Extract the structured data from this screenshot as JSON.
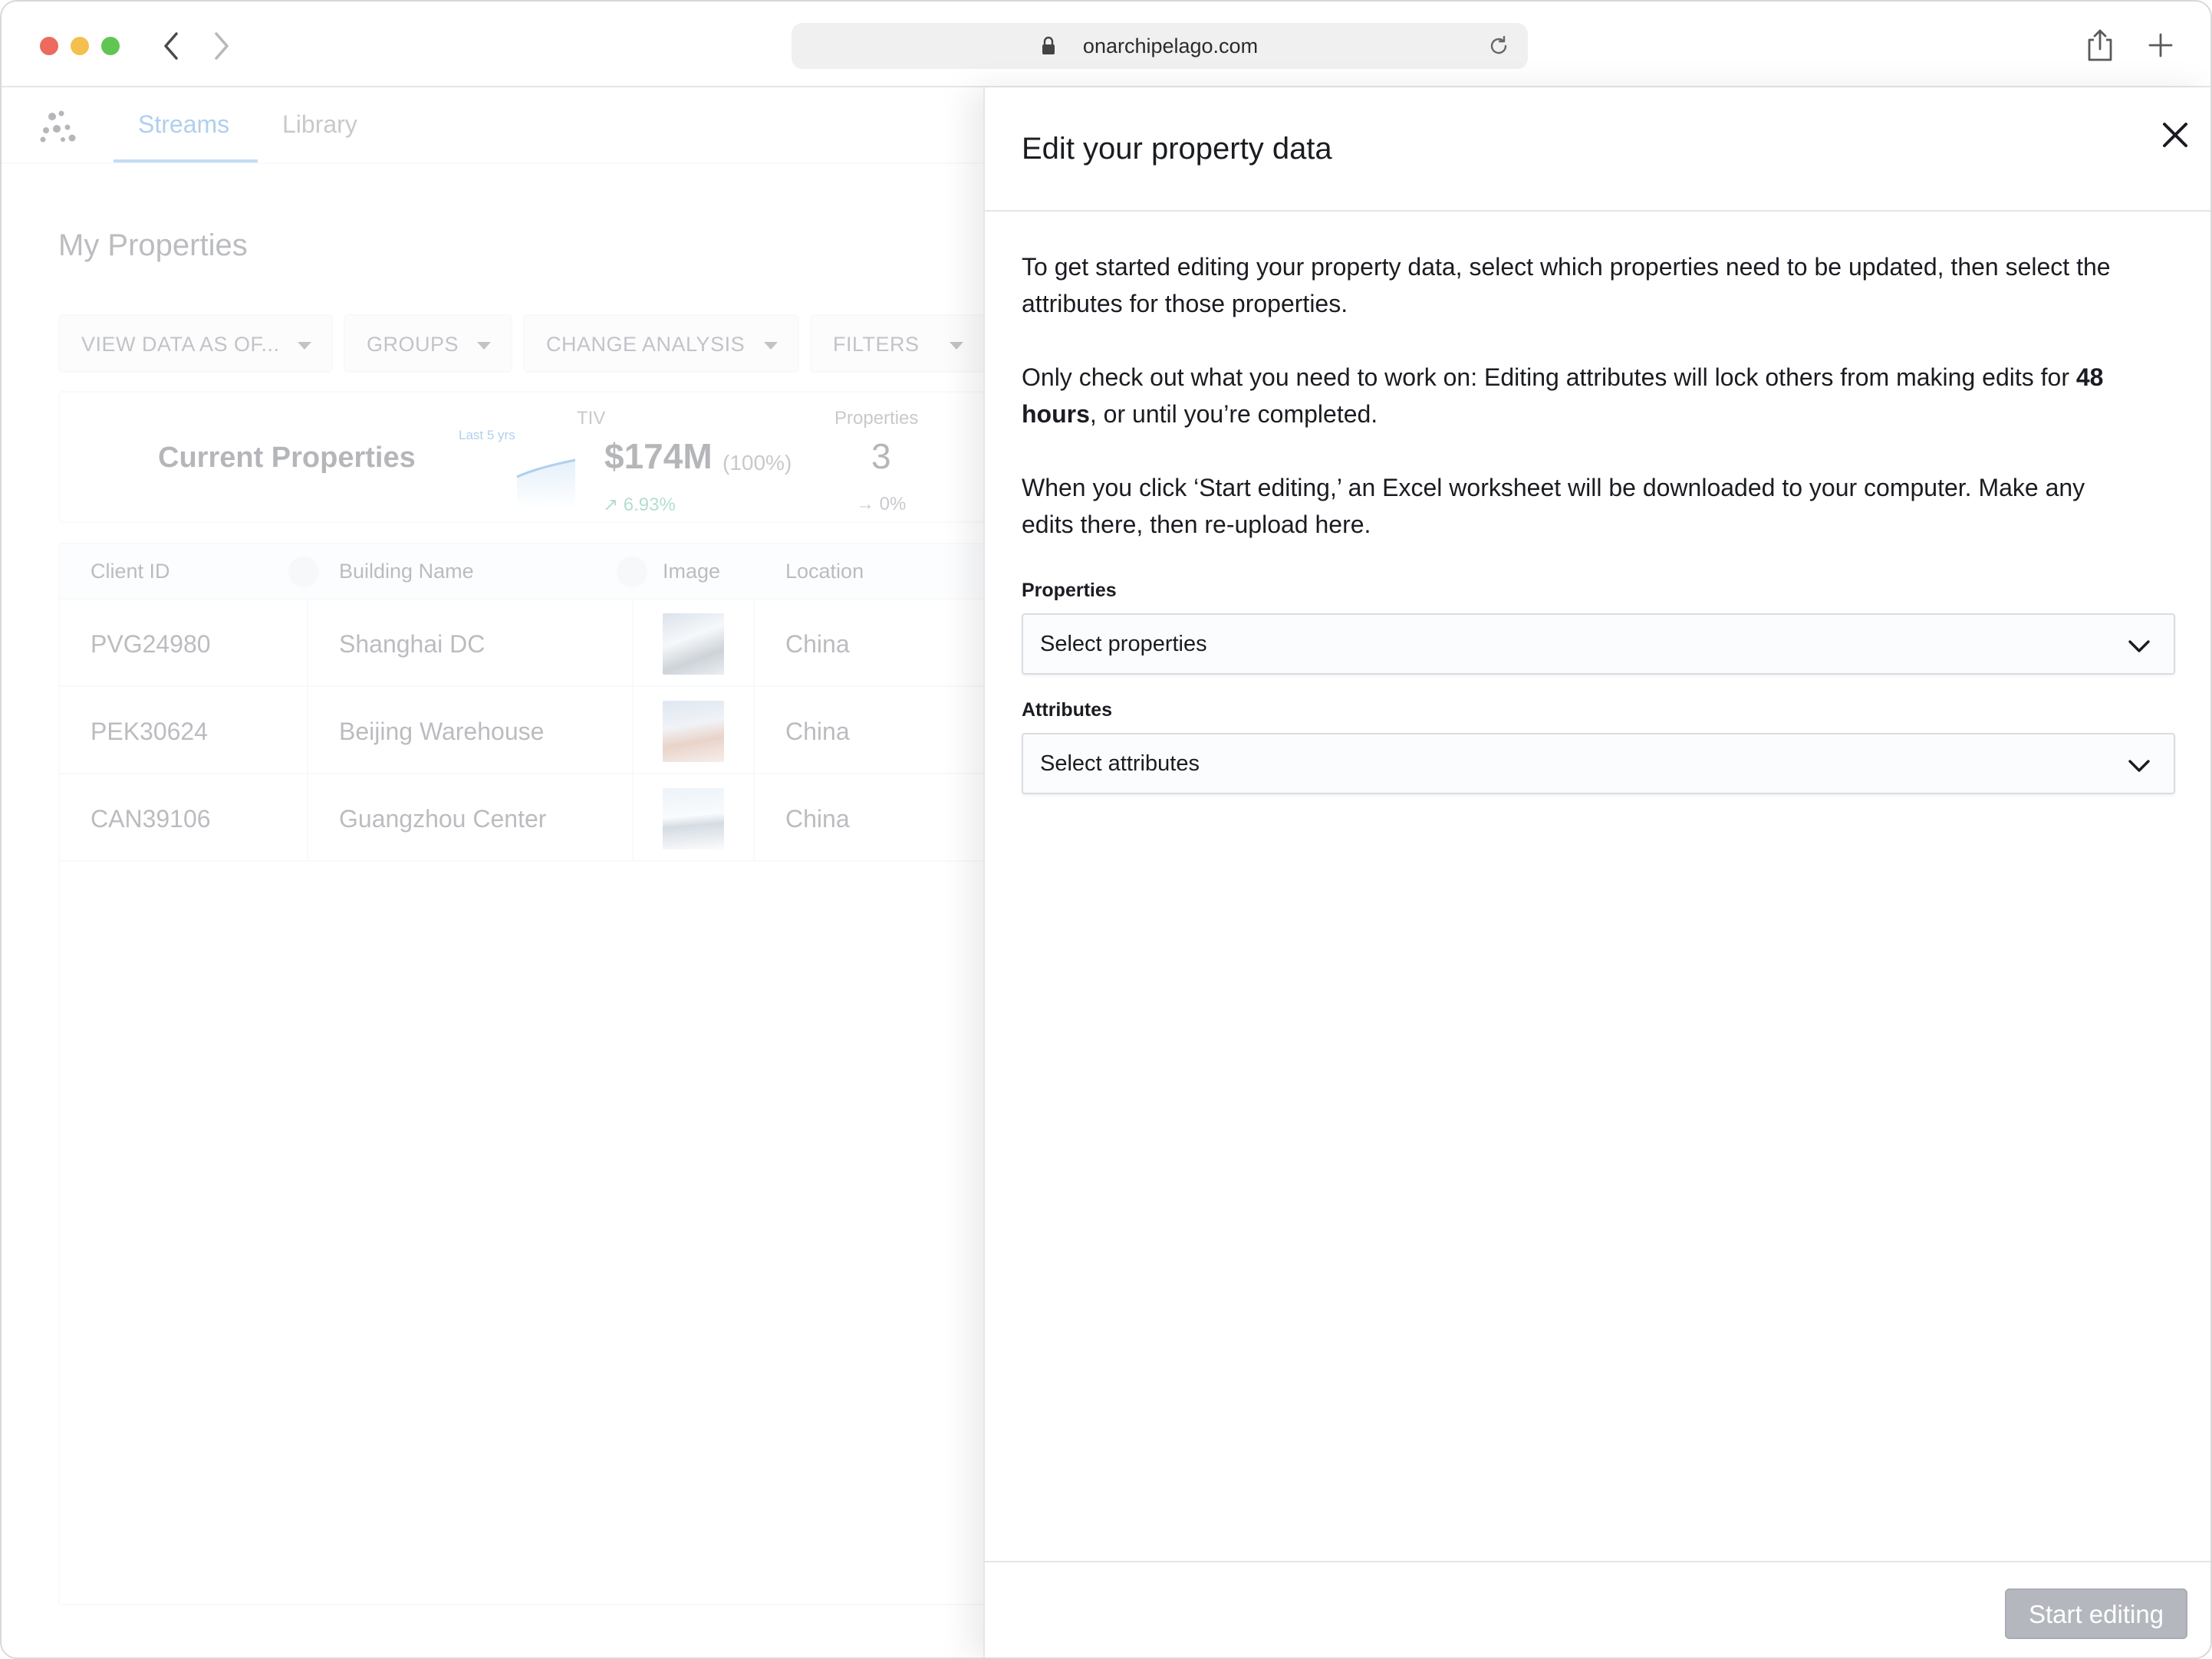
{
  "browser": {
    "url": "onarchipelago.com"
  },
  "app": {
    "tabs": [
      {
        "label": "Streams"
      },
      {
        "label": "Library"
      }
    ],
    "page_title": "My Properties",
    "filters": [
      {
        "label": "VIEW DATA AS OF..."
      },
      {
        "label": "GROUPS"
      },
      {
        "label": "CHANGE ANALYSIS"
      },
      {
        "label": "FILTERS"
      }
    ],
    "summary": {
      "title": "Current Properties",
      "spark_label": "Last 5 yrs",
      "tiv_label": "TIV",
      "tiv_value": "$174M",
      "tiv_pct": "(100%)",
      "tiv_change": "↗ 6.93%",
      "properties_label": "Properties",
      "properties_value": "3",
      "properties_change": "→ 0%"
    },
    "table": {
      "headers": [
        "Client ID",
        "Building Name",
        "Image",
        "Location"
      ],
      "rows": [
        {
          "client_id": "PVG24980",
          "building": "Shanghai DC",
          "location": "China"
        },
        {
          "client_id": "PEK30624",
          "building": "Beijing Warehouse",
          "location": "China"
        },
        {
          "client_id": "CAN39106",
          "building": "Guangzhou Center",
          "location": "China"
        }
      ]
    }
  },
  "drawer": {
    "title": "Edit your property data",
    "para1": "To get started editing your property data, select which properties need to be updated, then select the attributes for those properties.",
    "para2_pre": "Only check out what you need to work on: Editing attributes will lock others from making edits for ",
    "para2_bold": "48 hours",
    "para2_post": ", or until you’re completed.",
    "para3": "When you click ‘Start editing,’ an Excel worksheet will be downloaded to your computer. Make any edits there, then re-upload here.",
    "properties_label": "Properties",
    "properties_placeholder": "Select properties",
    "attributes_label": "Attributes",
    "attributes_placeholder": "Select attributes",
    "start_button": "Start editing"
  },
  "colors": {
    "accent": "#2f7fd1",
    "positive": "#36a87b",
    "disabled_button": "#b4b7bd"
  }
}
